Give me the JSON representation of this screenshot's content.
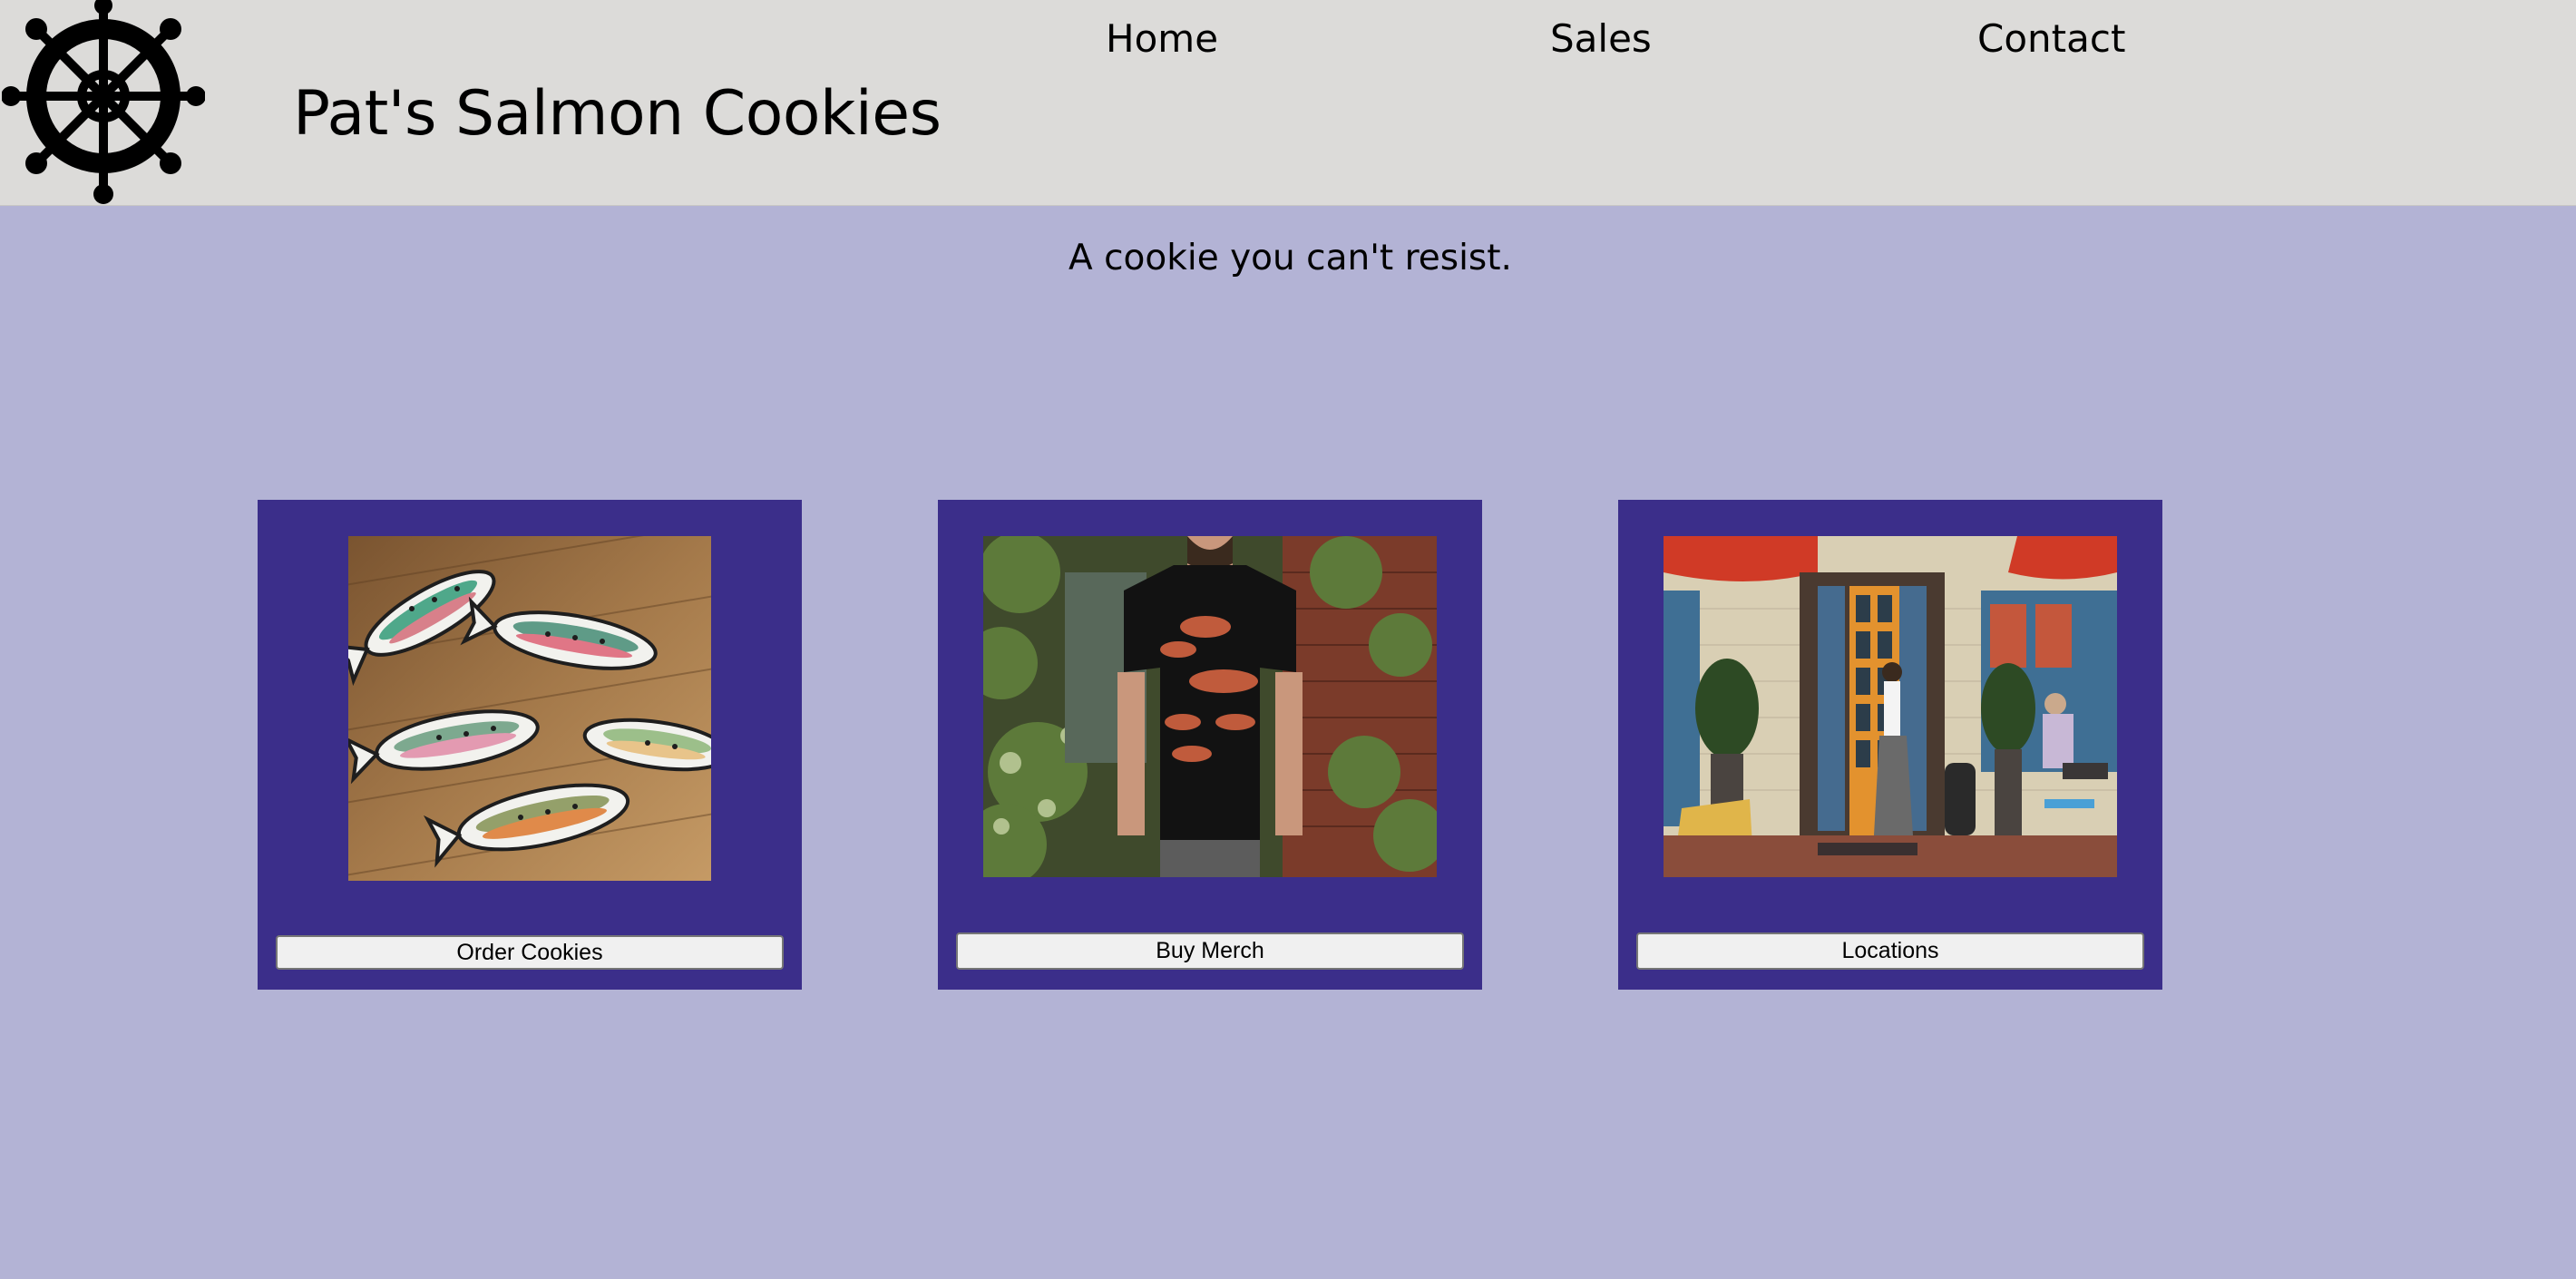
{
  "header": {
    "brand_title": "Pat's Salmon Cookies",
    "logo_icon": "ship-wheel-icon",
    "background": "#dcdbd9"
  },
  "nav": {
    "items": [
      {
        "label": "Home"
      },
      {
        "label": "Sales"
      },
      {
        "label": "Contact"
      }
    ]
  },
  "main": {
    "tagline": "A cookie you can't resist.",
    "background": "#b3b3d5",
    "cards": [
      {
        "image": "salmon-cookies-photo",
        "button_label": "Order Cookies"
      },
      {
        "image": "salmon-tshirt-photo",
        "button_label": "Buy Merch"
      },
      {
        "image": "storefront-photo",
        "button_label": "Locations"
      }
    ],
    "card_color": "#3b2e8a"
  }
}
